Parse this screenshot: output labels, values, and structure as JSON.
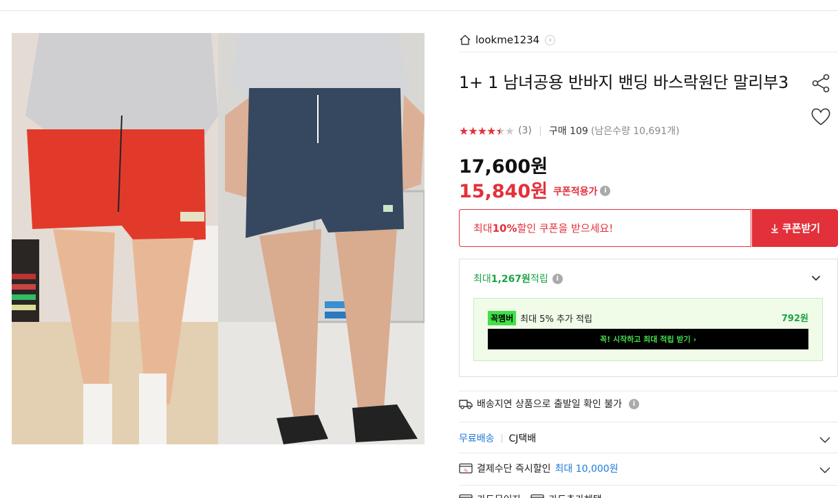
{
  "seller": {
    "name": "lookme1234",
    "home_icon": "home-icon",
    "chevron_icon": "chevron-right-icon"
  },
  "product": {
    "title": "1+ 1 남녀공용 반바지 밴딩 바스락원단 말리부3",
    "rating": 4.5,
    "review_count": "(3)",
    "sold": "구매 109",
    "remaining": "(남은수량 10,691개)"
  },
  "price": {
    "original": "17,600원",
    "sale": "15,840원",
    "sale_label": "쿠폰적용가"
  },
  "coupon": {
    "pre": "최대 ",
    "highlight": "10%",
    "post": " 할인 쿠폰을 받으세요!",
    "button": "쿠폰받기"
  },
  "points": {
    "pre": "최대 ",
    "amount": "1,267원",
    "post": " 적립",
    "member_badge": "꼭멤버",
    "member_text": "최대 5% 추가 적립",
    "member_amount": "792원",
    "member_cta": "꼭! 시작하고 최대 적립 받기 ›"
  },
  "shipping": {
    "delay_text": "배송지연 상품으로 출발일 확인 불가",
    "free_label": "무료배송",
    "carrier": "CJ택배",
    "pay_label": "결제수단 즉시할인",
    "pay_highlight": "최대 10,000원",
    "cut_a": "카드무이자",
    "cut_b": "카드추가혜택"
  },
  "colors": {
    "accent": "#e2313b",
    "green": "#1aa344",
    "link": "#1d7bd8"
  }
}
